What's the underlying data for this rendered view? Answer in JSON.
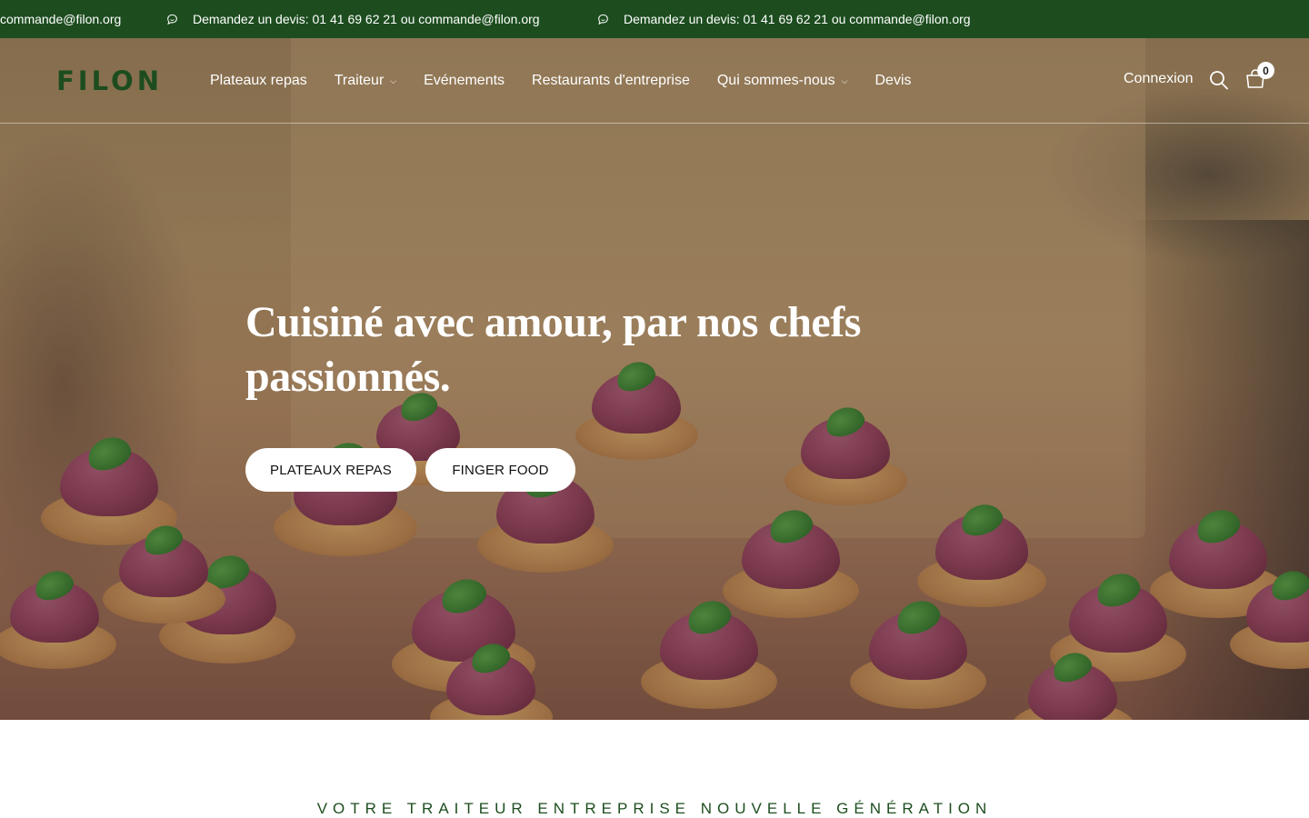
{
  "announcement": {
    "partial_text": "commande@filon.org",
    "items": [
      "Demandez un devis: 01 41 69 62 21 ou commande@filon.org",
      "Demandez un devis: 01 41 69 62 21 ou commande@filon.org"
    ],
    "icon": "chat-bubble-icon",
    "background_color": "#1d4d1f"
  },
  "header": {
    "logo": "FILON",
    "logo_color": "#1d4d1f",
    "nav": {
      "plateaux": "Plateaux repas",
      "traiteur": "Traiteur",
      "evenements": "Evénements",
      "restaurants": "Restaurants d'entreprise",
      "qui": "Qui sommes-nous",
      "devis": "Devis"
    },
    "login": "Connexion",
    "cart_count": "0"
  },
  "hero": {
    "title": "Cuisiné avec amour, par nos chefs passionnés.",
    "buttons": {
      "primary": "PLATEAUX REPAS",
      "secondary": "FINGER FOOD"
    }
  },
  "section": {
    "tagline": "VOTRE TRAITEUR ENTREPRISE NOUVELLE GÉNÉRATION"
  }
}
